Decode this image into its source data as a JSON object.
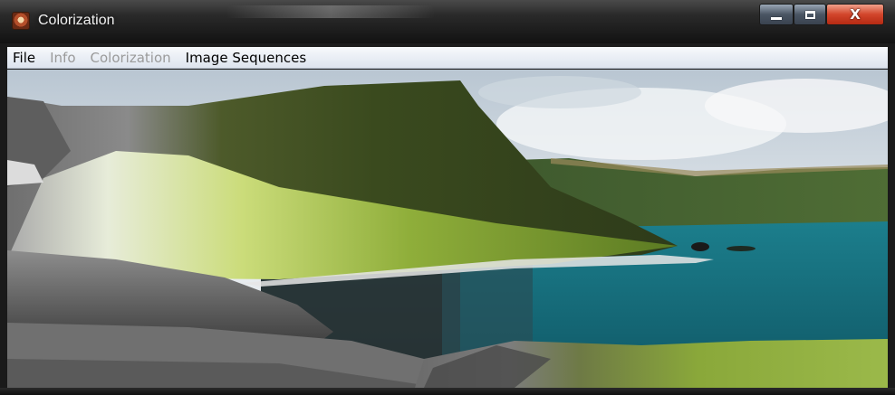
{
  "window": {
    "title": "Colorization",
    "controls": {
      "minimize": "minimize-icon",
      "maximize": "maximize-icon",
      "close": "close-icon",
      "close_glyph": "X"
    }
  },
  "menu": {
    "items": [
      {
        "label": "File",
        "enabled": true
      },
      {
        "label": "Info",
        "enabled": false
      },
      {
        "label": "Colorization",
        "enabled": false
      },
      {
        "label": "Image Sequences",
        "enabled": true
      }
    ]
  },
  "colors": {
    "sea": "#1f7a86",
    "grass": "#8fae3a",
    "close_button": "#d2452b"
  }
}
